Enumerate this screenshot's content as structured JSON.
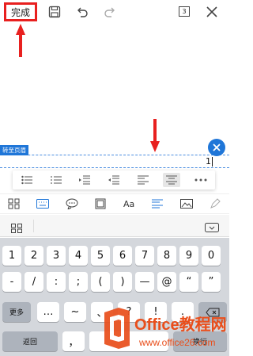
{
  "toolbar": {
    "done_label": "完成",
    "page_count": "3"
  },
  "header": {
    "goto_header_label": "转至页眉",
    "page_number": "1"
  },
  "colors": {
    "accent": "#1f76d8",
    "highlight": "#e8201f",
    "watermark": "#e94e1b"
  },
  "keyboard": {
    "row1": [
      "1",
      "2",
      "3",
      "4",
      "5",
      "6",
      "7",
      "8",
      "9",
      "0"
    ],
    "row2": [
      "-",
      "/",
      ":",
      ";",
      "(",
      ")",
      "—",
      "@",
      "“",
      "”"
    ],
    "row3": [
      "…",
      "~",
      "、",
      "?",
      "!",
      "."
    ],
    "more_label": "更多",
    "back_label": "返回",
    "comma": "，",
    "wrap_label": "换行"
  },
  "watermark": {
    "brand": "Office教程网",
    "url": "www.office26.com"
  }
}
